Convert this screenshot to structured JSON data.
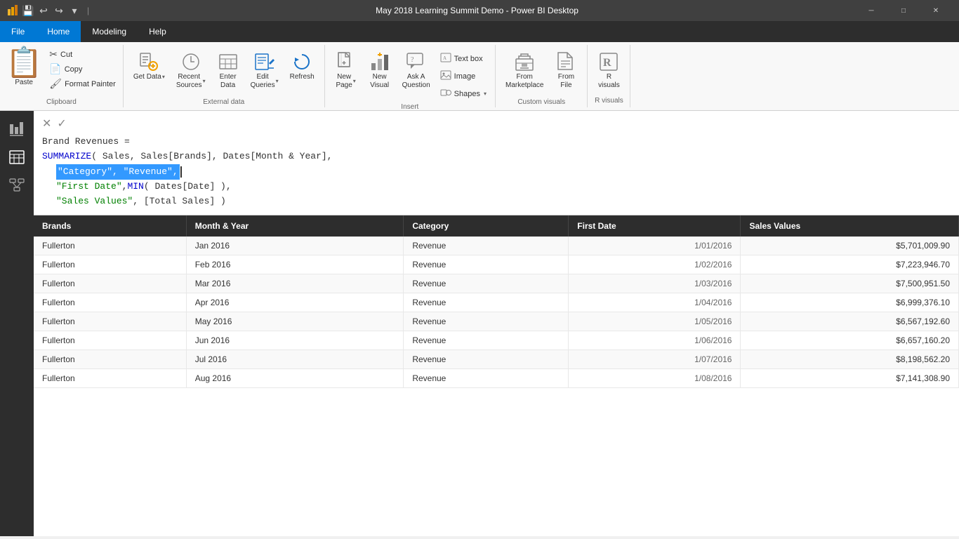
{
  "titleBar": {
    "title": "May 2018 Learning Summit Demo - Power BI Desktop",
    "icons": [
      "chart-icon",
      "save-icon",
      "undo-icon",
      "redo-icon",
      "customize-icon"
    ]
  },
  "menuBar": {
    "items": [
      {
        "id": "file",
        "label": "File",
        "active": false,
        "file": true
      },
      {
        "id": "home",
        "label": "Home",
        "active": true,
        "file": false
      },
      {
        "id": "modeling",
        "label": "Modeling",
        "active": false,
        "file": false
      },
      {
        "id": "help",
        "label": "Help",
        "active": false,
        "file": false
      }
    ]
  },
  "ribbon": {
    "groups": [
      {
        "id": "clipboard",
        "label": "Clipboard",
        "buttons": [
          {
            "id": "paste",
            "label": "Paste",
            "icon": "📋",
            "large": true
          },
          {
            "id": "cut",
            "label": "Cut",
            "icon": "✂️",
            "small": true
          },
          {
            "id": "copy",
            "label": "Copy",
            "icon": "📄",
            "small": true
          },
          {
            "id": "format-painter",
            "label": "Format Painter",
            "icon": "🖌️",
            "small": true
          }
        ]
      },
      {
        "id": "external-data",
        "label": "External data",
        "buttons": [
          {
            "id": "get-data",
            "label": "Get\nData",
            "hasDropdown": true
          },
          {
            "id": "recent-sources",
            "label": "Recent\nSources",
            "hasDropdown": true
          },
          {
            "id": "enter-data",
            "label": "Enter\nData",
            "hasDropdown": false
          },
          {
            "id": "edit-queries",
            "label": "Edit\nQueries",
            "hasDropdown": true,
            "special": true
          },
          {
            "id": "refresh",
            "label": "Refresh",
            "hasDropdown": false
          }
        ]
      },
      {
        "id": "insert",
        "label": "Insert",
        "buttons": [
          {
            "id": "new-page",
            "label": "New\nPage",
            "hasDropdown": true
          },
          {
            "id": "new-visual",
            "label": "New\nVisual",
            "hasDropdown": false
          },
          {
            "id": "ask-question",
            "label": "Ask A\nQuestion",
            "hasDropdown": false
          },
          {
            "id": "text-box",
            "label": "Text box",
            "small": true
          },
          {
            "id": "image",
            "label": "Image",
            "small": true
          },
          {
            "id": "shapes",
            "label": "Shapes",
            "small": true,
            "hasDropdown": true
          }
        ]
      },
      {
        "id": "custom-visuals",
        "label": "Custom visuals",
        "buttons": [
          {
            "id": "from-marketplace",
            "label": "From\nMarketplace",
            "hasDropdown": false
          },
          {
            "id": "from-file",
            "label": "From\nFile",
            "hasDropdown": false
          }
        ]
      }
    ]
  },
  "sidebar": {
    "icons": [
      {
        "id": "report",
        "icon": "📊",
        "active": false
      },
      {
        "id": "data",
        "icon": "⊞",
        "active": true
      },
      {
        "id": "model",
        "icon": "⊡",
        "active": false
      }
    ]
  },
  "formulaBar": {
    "measureName": "Brand Revenues =",
    "line1": "SUMMARIZE( Sales, Sales[Brands], Dates[Month & Year],",
    "line2_selected": "\"Category\", \"Revenue\",",
    "line3": "\"First Date\", MIN( Dates[Date] ),",
    "line4": "\"Sales Values\", [Total Sales] )"
  },
  "table": {
    "columns": [
      "Brands",
      "Month & Year",
      "Category",
      "First Date",
      "Sales Values"
    ],
    "rows": [
      {
        "brand": "Fullerton",
        "monthYear": "Jan 2016",
        "category": "Revenue",
        "firstDate": "1/01/2016",
        "salesValues": "$5,701,009.90"
      },
      {
        "brand": "Fullerton",
        "monthYear": "Feb 2016",
        "category": "Revenue",
        "firstDate": "1/02/2016",
        "salesValues": "$7,223,946.70"
      },
      {
        "brand": "Fullerton",
        "monthYear": "Mar 2016",
        "category": "Revenue",
        "firstDate": "1/03/2016",
        "salesValues": "$7,500,951.50"
      },
      {
        "brand": "Fullerton",
        "monthYear": "Apr 2016",
        "category": "Revenue",
        "firstDate": "1/04/2016",
        "salesValues": "$6,999,376.10"
      },
      {
        "brand": "Fullerton",
        "monthYear": "May 2016",
        "category": "Revenue",
        "firstDate": "1/05/2016",
        "salesValues": "$6,567,192.60"
      },
      {
        "brand": "Fullerton",
        "monthYear": "Jun 2016",
        "category": "Revenue",
        "firstDate": "1/06/2016",
        "salesValues": "$6,657,160.20"
      },
      {
        "brand": "Fullerton",
        "monthYear": "Jul 2016",
        "category": "Revenue",
        "firstDate": "1/07/2016",
        "salesValues": "$8,198,562.20"
      },
      {
        "brand": "Fullerton",
        "monthYear": "Aug 2016",
        "category": "Revenue",
        "firstDate": "1/08/2016",
        "salesValues": "$7,141,308.90"
      }
    ]
  }
}
